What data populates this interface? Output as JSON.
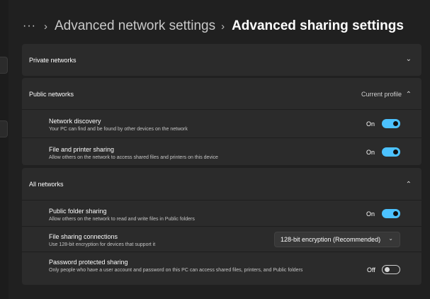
{
  "breadcrumb": {
    "more": "···",
    "separator": "›",
    "parent": "Advanced network settings",
    "current": "Advanced sharing settings"
  },
  "sections": {
    "private": {
      "title": "Private networks",
      "chevron": "⌄"
    },
    "public": {
      "title": "Public networks",
      "profile": "Current profile",
      "chevron": "⌃",
      "items": [
        {
          "title": "Network discovery",
          "description": "Your PC can find and be found by other devices on the network",
          "state": "On",
          "toggle": true
        },
        {
          "title": "File and printer sharing",
          "description": "Allow others on the network to access shared files and printers on this device",
          "state": "On",
          "toggle": true
        }
      ]
    },
    "all": {
      "title": "All networks",
      "chevron": "⌃",
      "items": [
        {
          "title": "Public folder sharing",
          "description": "Allow others on the network to read and write files in Public folders",
          "state": "On",
          "toggle": true
        },
        {
          "title": "File sharing connections",
          "description": "Use 128-bit encryption for devices that support it",
          "dropdown_value": "128-bit encryption (Recommended)",
          "dropdown_chevron": "⌄"
        },
        {
          "title": "Password protected sharing",
          "description": "Only people who have a user account and password on this PC can access shared files, printers, and Public folders",
          "state": "Off",
          "toggle": false
        }
      ]
    }
  },
  "colors": {
    "background": "#202020",
    "panel": "#2b2b2b",
    "accent": "#4cc2ff"
  }
}
